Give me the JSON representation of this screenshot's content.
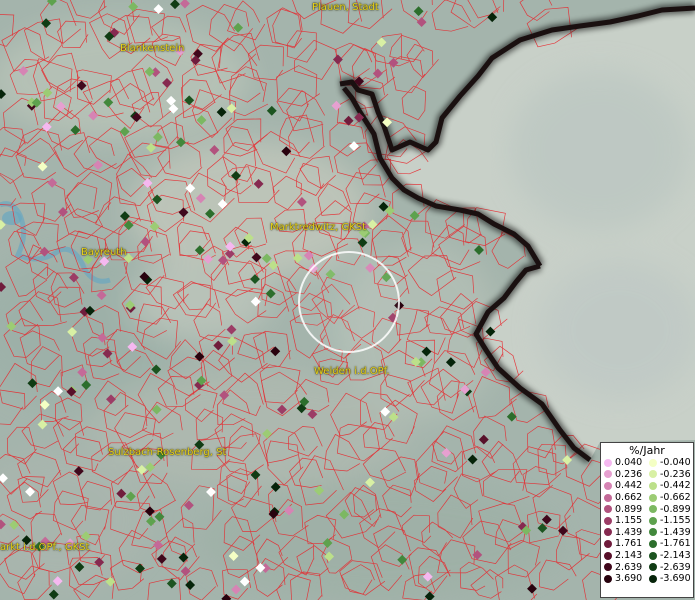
{
  "places": [
    {
      "id": "plauen",
      "label": "Plauen, Stadt"
    },
    {
      "id": "blankenstein",
      "label": "Blankenstein"
    },
    {
      "id": "bayreuth",
      "label": "Bayreuth"
    },
    {
      "id": "marktredwitz",
      "label": "Marktredwitz, GKSt"
    },
    {
      "id": "weiden",
      "label": "Weiden i.d.OPf."
    },
    {
      "id": "sulzbach",
      "label": "Sulzbach-Rosenberg, St"
    },
    {
      "id": "neumarkt",
      "label": "arkt i.d.OPf., GKSt"
    }
  ],
  "legend": {
    "title": "%/Jahr",
    "positive": [
      {
        "value": "0.040",
        "color": "#f5b8f0"
      },
      {
        "value": "0.236",
        "color": "#e6a0d0"
      },
      {
        "value": "0.442",
        "color": "#d684b4"
      },
      {
        "value": "0.662",
        "color": "#c46a98"
      },
      {
        "value": "0.899",
        "color": "#b2527e"
      },
      {
        "value": "1.155",
        "color": "#9c3c66"
      },
      {
        "value": "1.439",
        "color": "#862a50"
      },
      {
        "value": "1.761",
        "color": "#701c3c"
      },
      {
        "value": "2.143",
        "color": "#58102a"
      },
      {
        "value": "2.639",
        "color": "#40081c"
      },
      {
        "value": "3.690",
        "color": "#28020e"
      }
    ],
    "negative": [
      {
        "value": "-0.040",
        "color": "#f4ffc4"
      },
      {
        "value": "-0.236",
        "color": "#d8f0a4"
      },
      {
        "value": "-0.442",
        "color": "#bce08a"
      },
      {
        "value": "-0.662",
        "color": "#9ccc74"
      },
      {
        "value": "-0.899",
        "color": "#7cb862"
      },
      {
        "value": "-1.155",
        "color": "#5ea24e"
      },
      {
        "value": "-1.439",
        "color": "#42883c"
      },
      {
        "value": "-1.761",
        "color": "#2c6e2c"
      },
      {
        "value": "-2.143",
        "color": "#1c5420"
      },
      {
        "value": "-2.639",
        "color": "#103c14"
      },
      {
        "value": "-3.690",
        "color": "#06240a"
      }
    ]
  },
  "colors": {
    "background": "#a9b8b0",
    "boundary": "#e8242a",
    "border": "#1a1010",
    "czech": "#c4ccc4",
    "label": "#e8d21a"
  }
}
